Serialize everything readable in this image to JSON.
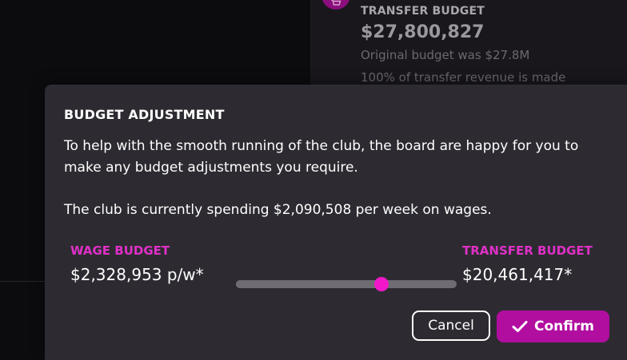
{
  "background_panel": {
    "icon": "shopping-cart-icon",
    "title": "TRANSFER BUDGET",
    "value": "$27,800,827",
    "note_original": "Original budget was $27.8M",
    "note_revenue": "100% of transfer revenue is made"
  },
  "modal": {
    "title": "BUDGET ADJUSTMENT",
    "body_intro": "To help with the smooth running of the club, the board are happy for you to make any budget adjustments you require.",
    "body_spending": "The club is currently spending $2,090,508 per week on wages.",
    "wage_budget": {
      "label": "WAGE BUDGET",
      "value": "$2,328,953 p/w*"
    },
    "transfer_budget": {
      "label": "TRANSFER BUDGET",
      "value": "$20,461,417*"
    },
    "slider": {
      "position_fraction": 0.66
    },
    "buttons": {
      "cancel_label": "Cancel",
      "confirm_label": "Confirm",
      "confirm_icon": "checkmark-icon"
    }
  },
  "colors": {
    "accent": "#e030c8",
    "confirm_button": "#b10ea0",
    "slider_thumb": "#f018c8",
    "modal_bg": "#2d2b31"
  }
}
